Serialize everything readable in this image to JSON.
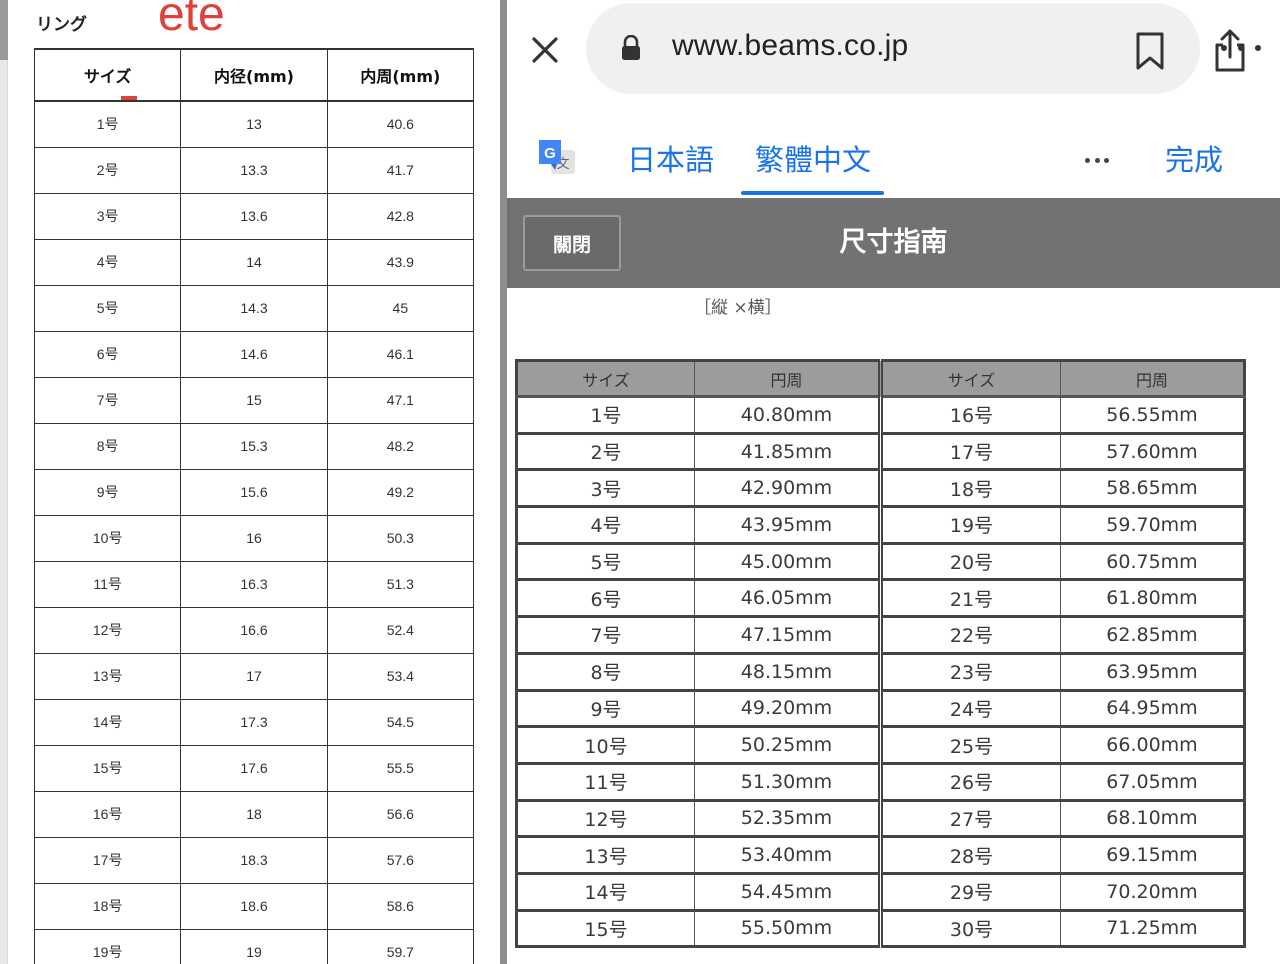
{
  "left_doc": {
    "title": "リング",
    "brand": "ete",
    "headers": [
      "サイズ",
      "内径(mm)",
      "内周(mm)"
    ],
    "rows": [
      [
        "1号",
        "13",
        "40.6"
      ],
      [
        "2号",
        "13.3",
        "41.7"
      ],
      [
        "3号",
        "13.6",
        "42.8"
      ],
      [
        "4号",
        "14",
        "43.9"
      ],
      [
        "5号",
        "14.3",
        "45"
      ],
      [
        "6号",
        "14.6",
        "46.1"
      ],
      [
        "7号",
        "15",
        "47.1"
      ],
      [
        "8号",
        "15.3",
        "48.2"
      ],
      [
        "9号",
        "15.6",
        "49.2"
      ],
      [
        "10号",
        "16",
        "50.3"
      ],
      [
        "11号",
        "16.3",
        "51.3"
      ],
      [
        "12号",
        "16.6",
        "52.4"
      ],
      [
        "13号",
        "17",
        "53.4"
      ],
      [
        "14号",
        "17.3",
        "54.5"
      ],
      [
        "15号",
        "17.6",
        "55.5"
      ],
      [
        "16号",
        "18",
        "56.6"
      ],
      [
        "17号",
        "18.3",
        "57.6"
      ],
      [
        "18号",
        "18.6",
        "58.6"
      ],
      [
        "19号",
        "19",
        "59.7"
      ]
    ]
  },
  "browser": {
    "url": "www.beams.co.jp",
    "icons": {
      "close": "close-icon",
      "lock": "lock-icon",
      "bookmark": "bookmark-icon",
      "share": "share-icon",
      "menu": "more-icon"
    }
  },
  "translate_bar": {
    "languages": [
      "日本語",
      "繁體中文"
    ],
    "active_language": "繁體中文",
    "done_label": "完成",
    "accent_color": "#1a73e8"
  },
  "modal": {
    "close_label": "關閉",
    "title": "尺寸指南",
    "dimension_note": "［縦 ×横］"
  },
  "size_table": {
    "headers": [
      "サイズ",
      "円周",
      "サイズ",
      "円周"
    ],
    "rows": [
      [
        "1号",
        "40.80mm",
        "16号",
        "56.55mm"
      ],
      [
        "2号",
        "41.85mm",
        "17号",
        "57.60mm"
      ],
      [
        "3号",
        "42.90mm",
        "18号",
        "58.65mm"
      ],
      [
        "4号",
        "43.95mm",
        "19号",
        "59.70mm"
      ],
      [
        "5号",
        "45.00mm",
        "20号",
        "60.75mm"
      ],
      [
        "6号",
        "46.05mm",
        "21号",
        "61.80mm"
      ],
      [
        "7号",
        "47.15mm",
        "22号",
        "62.85mm"
      ],
      [
        "8号",
        "48.15mm",
        "23号",
        "63.95mm"
      ],
      [
        "9号",
        "49.20mm",
        "24号",
        "64.95mm"
      ],
      [
        "10号",
        "50.25mm",
        "25号",
        "66.00mm"
      ],
      [
        "11号",
        "51.30mm",
        "26号",
        "67.05mm"
      ],
      [
        "12号",
        "52.35mm",
        "27号",
        "68.10mm"
      ],
      [
        "13号",
        "53.40mm",
        "28号",
        "69.15mm"
      ],
      [
        "14号",
        "54.45mm",
        "29号",
        "70.20mm"
      ],
      [
        "15号",
        "55.50mm",
        "30号",
        "71.25mm"
      ]
    ]
  }
}
